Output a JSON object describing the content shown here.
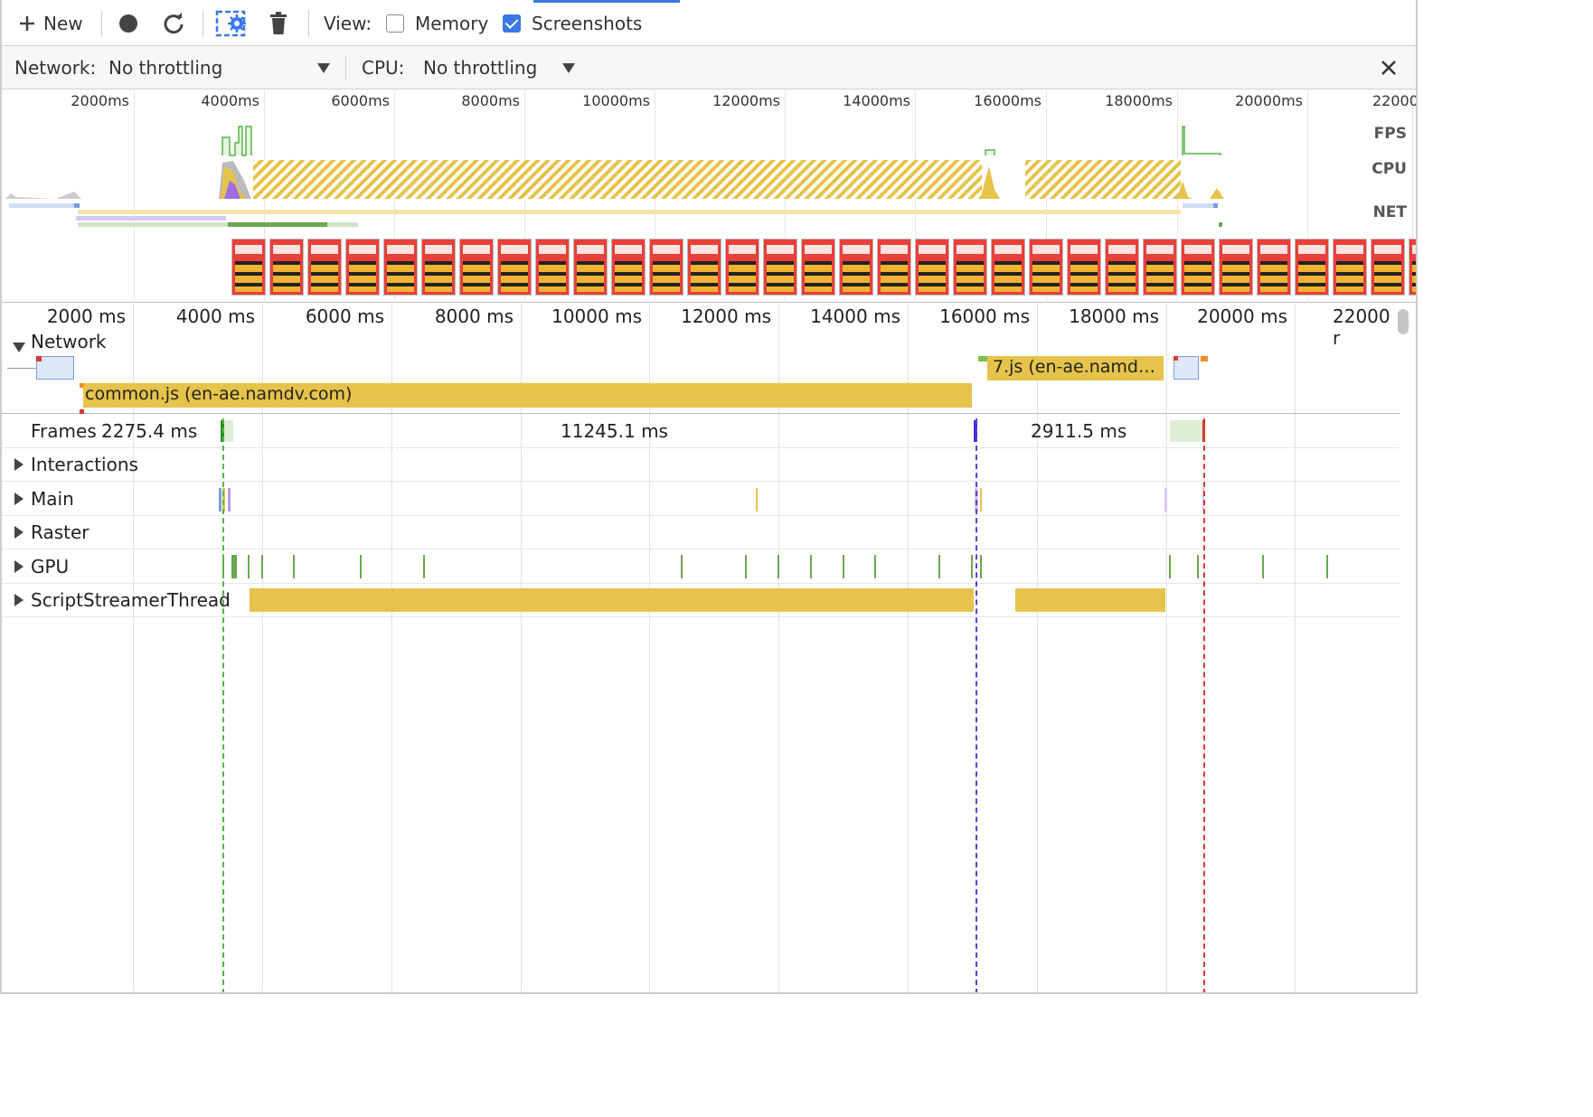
{
  "toolbar": {
    "new_label": "New",
    "view_label": "View:",
    "memory_label": "Memory",
    "memory_checked": false,
    "screenshots_label": "Screenshots",
    "screenshots_checked": true,
    "icons": [
      "plus-icon",
      "record-icon",
      "reload-icon",
      "capture-settings-icon",
      "trash-icon"
    ]
  },
  "throttling": {
    "network_label": "Network:",
    "network_value": "No throttling",
    "cpu_label": "CPU:",
    "cpu_value": "No throttling"
  },
  "overview": {
    "ticks": [
      "2000ms",
      "4000ms",
      "6000ms",
      "8000ms",
      "10000ms",
      "12000ms",
      "14000ms",
      "16000ms",
      "18000ms",
      "20000ms",
      "22000"
    ],
    "rows": {
      "fps": "FPS",
      "cpu": "CPU",
      "net": "NET"
    }
  },
  "flame": {
    "ticks": [
      "2000 ms",
      "4000 ms",
      "6000 ms",
      "8000 ms",
      "10000 ms",
      "12000 ms",
      "14000 ms",
      "16000 ms",
      "18000 ms",
      "20000 ms",
      "22000 r"
    ],
    "network_label": "Network",
    "network_requests": [
      {
        "label": "common.js (en-ae.namdv.com)"
      },
      {
        "label": "7.js (en-ae.namd…"
      }
    ],
    "frames": {
      "label": "Frames",
      "durations": [
        "2275.4 ms",
        "11245.1 ms",
        "2911.5 ms"
      ]
    },
    "tracks": [
      "Interactions",
      "Main",
      "Raster",
      "GPU",
      "ScriptStreamerThread"
    ]
  },
  "colors": {
    "accent": "#3b78e7",
    "script": "#e6c34a",
    "gpu": "#6aa84f",
    "dcl": "#5b3fd9",
    "load": "#d93a2f"
  }
}
